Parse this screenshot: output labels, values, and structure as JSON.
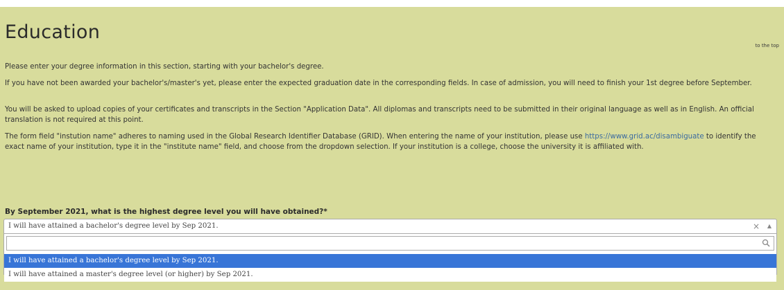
{
  "section": {
    "title": "Education",
    "to_top": "to the top"
  },
  "paragraphs": {
    "p1": "Please enter your degree information in this section, starting with your bachelor's degree.",
    "p2": "If you have not been awarded your bachelor's/master's yet, please enter the expected graduation date in the corresponding fields. In case of admission, you will need to finish your 1st degree before September.",
    "p3": "You will be asked to upload copies of your certificates and transcripts in the Section \"Application Data\". All diplomas and transcripts need to be submitted in their original language as well as in English. An official translation is not required at this point.",
    "p4_before": "The form field \"instution name\" adheres to naming used in the Global Research Identifier Database (GRID). When entering the name of your institution, please use ",
    "p4_link": "https://www.grid.ac/disambiguate",
    "p4_after": " to identify the exact name of your institution, type it in the \"institute name\" field, and choose from the dropdown selection. If your institution is a college, choose the university it is affiliated with."
  },
  "question": {
    "label": "By September 2021, what is the highest degree level you will have obtained?*"
  },
  "select": {
    "value": "I will have attained a bachelor's degree level by Sep 2021.",
    "clear_glyph": "×",
    "arrow_glyph": "▲",
    "search_value": "",
    "options": [
      {
        "label": "I will have attained a bachelor's degree level by Sep 2021."
      },
      {
        "label": "I will have attained a master's degree level (or higher) by Sep 2021."
      }
    ]
  },
  "colors": {
    "panel_background": "#d8dc9c",
    "highlight": "#3875d7",
    "link": "#3a6aa0"
  },
  "icons": {
    "search": "search-icon",
    "clear": "close-icon",
    "arrow": "chevron-up-icon"
  }
}
